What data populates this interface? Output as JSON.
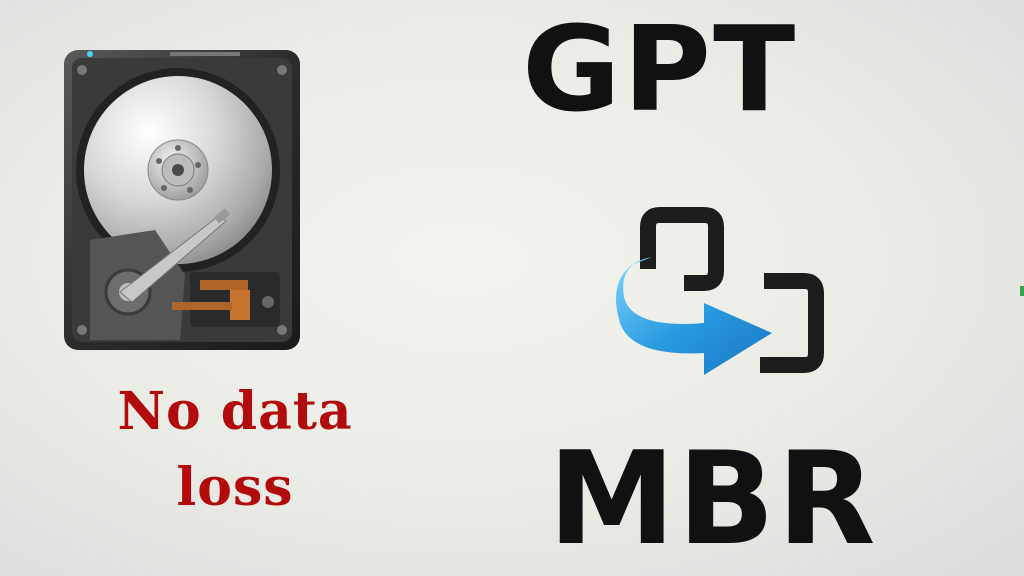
{
  "headline_top": "GPT",
  "headline_bottom": "MBR",
  "caption": {
    "line1": "No data",
    "line2": "loss"
  },
  "icons": {
    "drive": "hard-drive-icon",
    "conversion": "convert-arrow-icon"
  },
  "colors": {
    "caption": "#b20b0b",
    "headline": "#111111",
    "arrow": "#2a9be0",
    "background": "#ecece6"
  }
}
